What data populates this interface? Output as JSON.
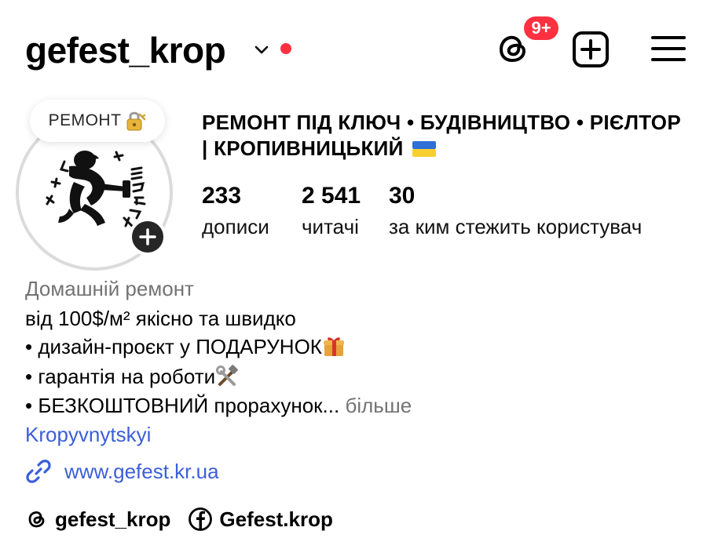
{
  "header": {
    "username": "gefest_krop",
    "notifications_badge": "9+",
    "live_dot_color": "#ff3040"
  },
  "avatar": {
    "note_text": "РЕМОНТ",
    "note_icon": "lock-with-key-icon"
  },
  "profile": {
    "full_name": "РЕМОНТ ПІД КЛЮЧ • БУДІВНИЦТВО • РІЄЛТОР | КРОПИВНИЦЬКИЙ",
    "stats": [
      {
        "value": "233",
        "label": "дописи"
      },
      {
        "value": "2 541",
        "label": "читачі"
      },
      {
        "value": "30",
        "label": "за ким стежить користувач"
      }
    ]
  },
  "bio": {
    "category": "Домашній ремонт",
    "line1": "від 100$/м² якісно та швидко",
    "line2": "• дизайн-проєкт у ПОДАРУНОК",
    "line3": "• гарантія на роботи",
    "line4": "• БЕЗКОШТОВНИЙ прорахунок...",
    "more": "більше",
    "location": "Kropyvnytskyi",
    "link": "www.gefest.kr.ua"
  },
  "social": {
    "threads": "gefest_krop",
    "facebook": "Gefest.krop"
  },
  "colors": {
    "accent_link": "#3b5fd9",
    "badge": "#ff3040",
    "muted": "#737373"
  }
}
